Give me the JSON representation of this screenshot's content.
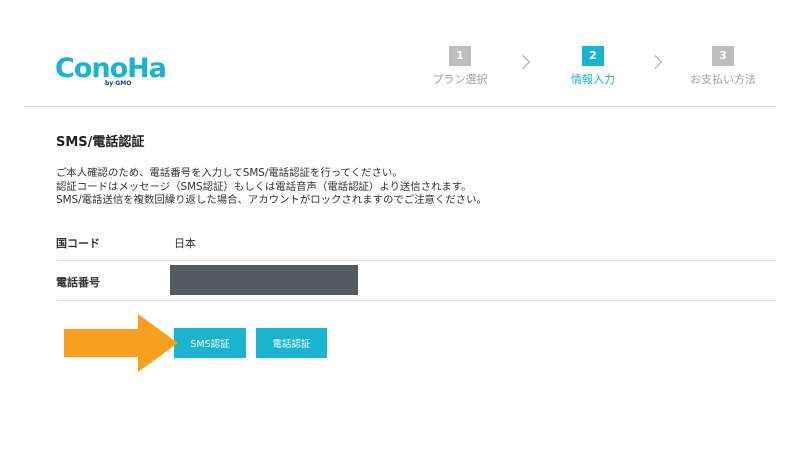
{
  "brand": {
    "logo_text": "ConoHa",
    "logo_sub": "by GMO",
    "accent": "#19b4d0"
  },
  "steps": [
    {
      "number": "1",
      "label": "プラン選択",
      "state": "done"
    },
    {
      "number": "2",
      "label": "情報入力",
      "state": "active"
    },
    {
      "number": "3",
      "label": "お支払い方法",
      "state": "pending"
    }
  ],
  "icons": {
    "step_separator": "chevron-right-icon",
    "pointer": "arrow-right-icon"
  },
  "section": {
    "title": "SMS/電話認証",
    "intro_lines": [
      "ご本人確認のため、電話番号を入力してSMS/電話認証を行ってください。",
      "認証コードはメッセージ（SMS認証）もしくは電話音声（電話認証）より送信されます。",
      "SMS/電話送信を複数回繰り返した場合、アカウントがロックされますのでご注意ください。"
    ]
  },
  "form": {
    "country": {
      "label": "国コード",
      "value": "日本"
    },
    "phone": {
      "label": "電話番号",
      "value": "",
      "redacted": true,
      "fill_color": "#555a60"
    }
  },
  "buttons": {
    "sms_label": "SMS認証",
    "voice_label": "電話認証",
    "button_color": "#19b4d0"
  },
  "annotation": {
    "arrow_color": "#f7a020"
  }
}
